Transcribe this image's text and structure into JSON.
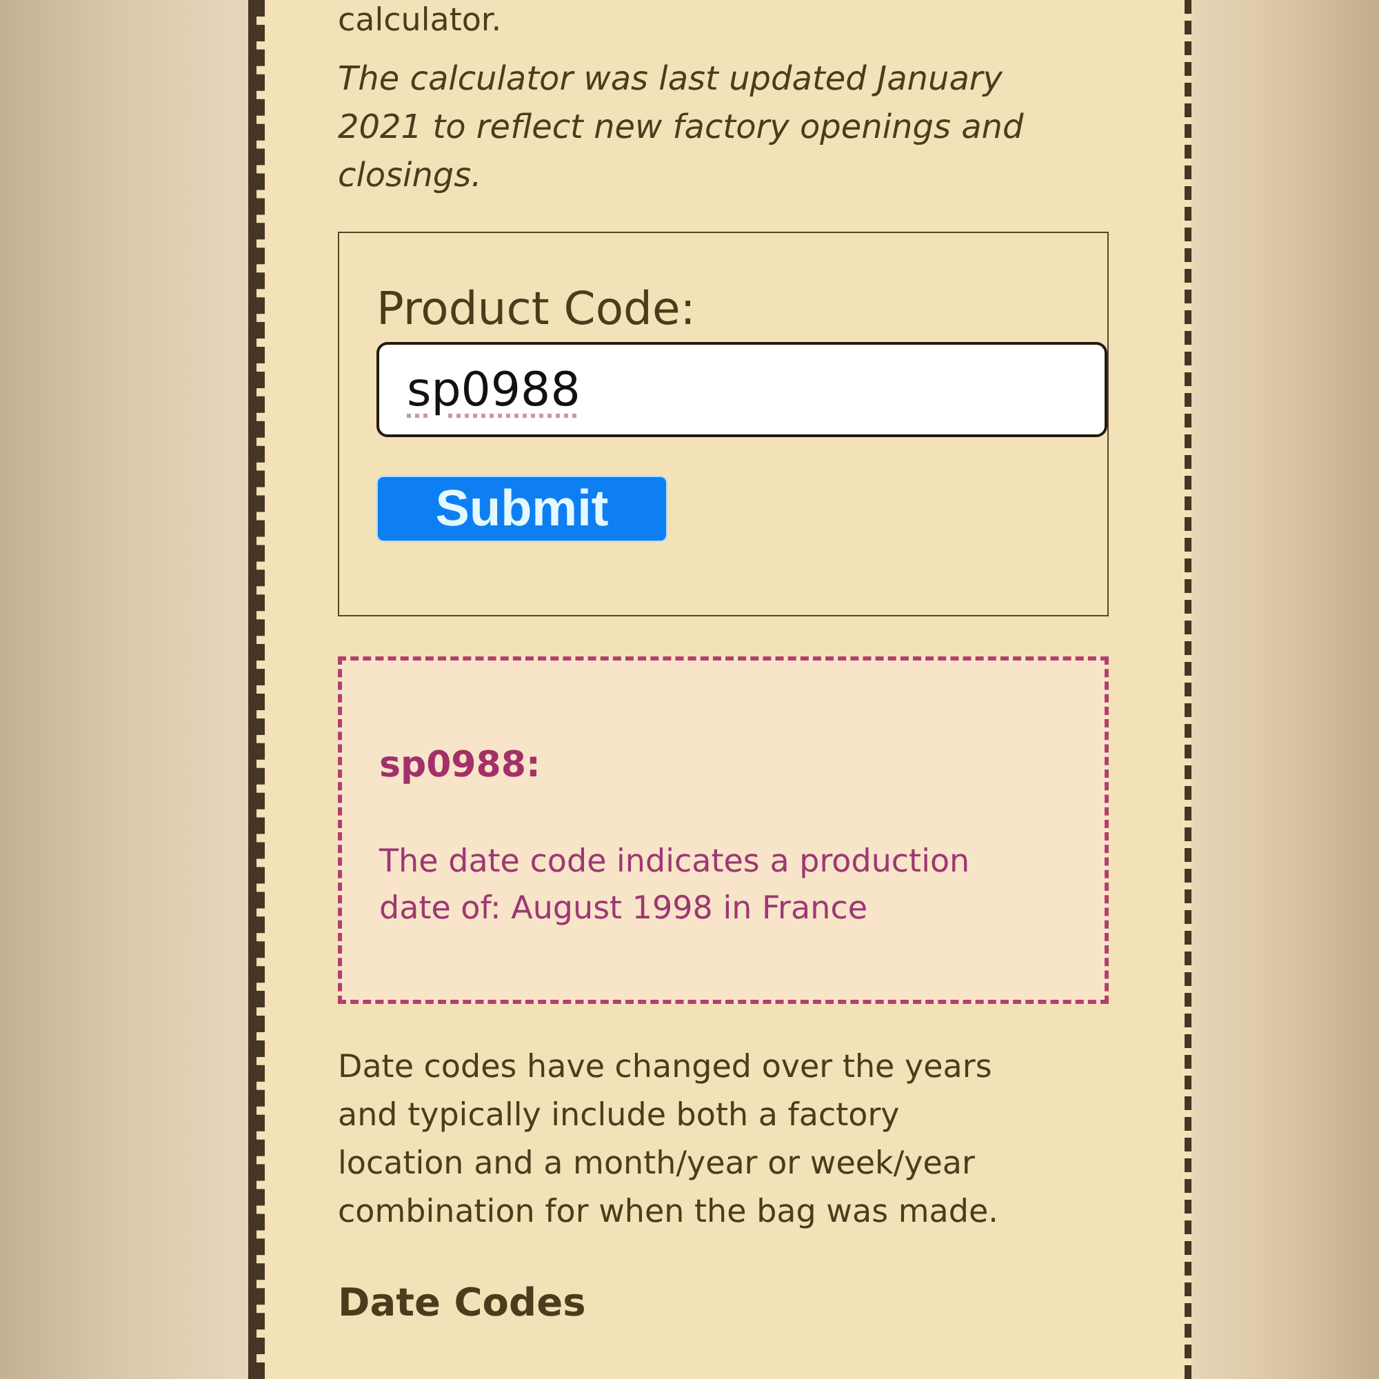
{
  "intro": {
    "tail": "calculator.",
    "update_note": "The calculator was last updated January 2021 to reflect new factory openings and closings."
  },
  "form": {
    "label": "Product Code:",
    "value": "sp0988",
    "button": "Submit"
  },
  "result": {
    "code": "sp0988:",
    "message": "The date code indicates a production date of: August 1998 in France"
  },
  "body": "Date codes have changed over the years and typically include both a factory location and a month/year or week/year combination for when the bag was made.",
  "section_heading": "Date Codes"
}
